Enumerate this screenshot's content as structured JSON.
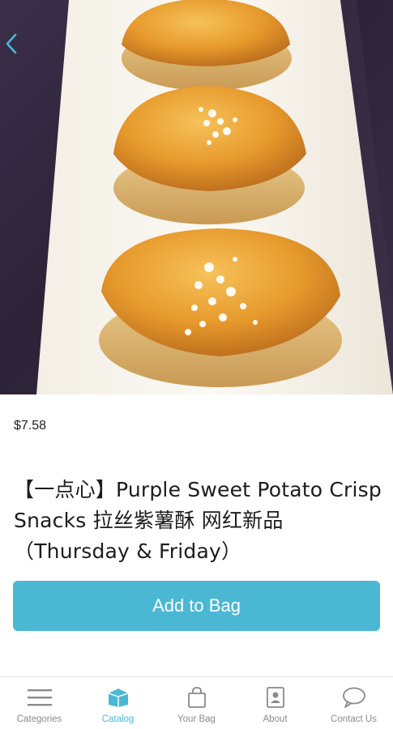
{
  "product": {
    "price": "$7.58",
    "title": "【一点心】Purple Sweet Potato Crisp Snacks 拉丝紫薯酥 网红新品（Thursday & Friday）",
    "add_to_bag_label": "Add to Bag",
    "image_description_icon": "pastry-photo"
  },
  "tabs": [
    {
      "label": "Categories",
      "icon": "menu-icon",
      "active": false
    },
    {
      "label": "Catalog",
      "icon": "box-icon",
      "active": true
    },
    {
      "label": "Your Bag",
      "icon": "bag-icon",
      "active": false
    },
    {
      "label": "About",
      "icon": "contact-card-icon",
      "active": false
    },
    {
      "label": "Contact Us",
      "icon": "chat-bubble-icon",
      "active": false
    }
  ],
  "colors": {
    "accent": "#4bb8d3",
    "tab_inactive": "#8a8a8a",
    "back_arrow": "#4bb8d3"
  }
}
